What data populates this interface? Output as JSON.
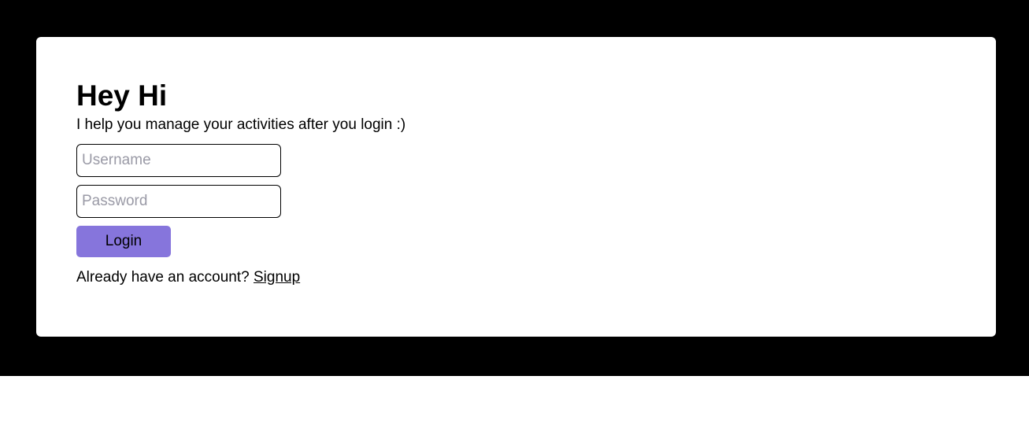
{
  "card": {
    "title": "Hey Hi",
    "subtitle": "I help you manage your activities after you login :)"
  },
  "form": {
    "username": {
      "value": "",
      "placeholder": "Username"
    },
    "password": {
      "value": "",
      "placeholder": "Password"
    },
    "login_label": "Login"
  },
  "footer": {
    "prompt": "Already have an account? ",
    "signup_label": "Signup"
  },
  "colors": {
    "backdrop": "#000000",
    "card": "#ffffff",
    "accent": "#8675dc"
  }
}
